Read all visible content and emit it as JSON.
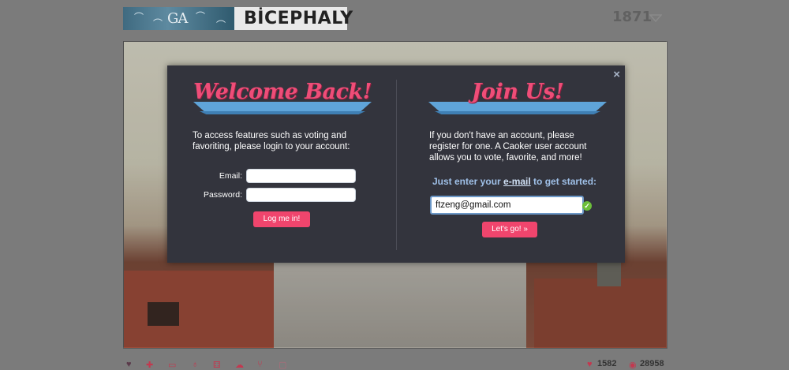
{
  "header": {
    "thumb_logo": "GA",
    "title": "BİCEPHALY",
    "score": "1871"
  },
  "modal": {
    "close_symbol": "×",
    "login": {
      "banner": "Welcome Back!",
      "intro": "To access features such as voting and favoriting, please login to your account:",
      "email_label": "Email:",
      "password_label": "Password:",
      "email_value": "",
      "password_value": "",
      "submit_label": "Log me in!"
    },
    "signup": {
      "banner": "Join Us!",
      "intro": "If you don't have an account, please register for one. A Caoker user account allows you to vote, favorite, and more!",
      "cta_prefix": "Just enter your ",
      "cta_link": "e-mail",
      "cta_suffix": " to get started:",
      "email_value": "ftzeng@gmail.com",
      "valid_icon": "check-icon",
      "submit_label": "Let's go! »"
    }
  },
  "footer": {
    "icons": [
      "heart-icon",
      "plus-icon",
      "screen-icon",
      "bulb-icon",
      "dice-icon",
      "cloud-icon",
      "branch-icon",
      "chat-icon"
    ],
    "likes": "1582",
    "views": "28958"
  },
  "colors": {
    "accent": "#f0456d",
    "modal_bg": "#33343d",
    "ribbon": "#5fa4d9"
  }
}
